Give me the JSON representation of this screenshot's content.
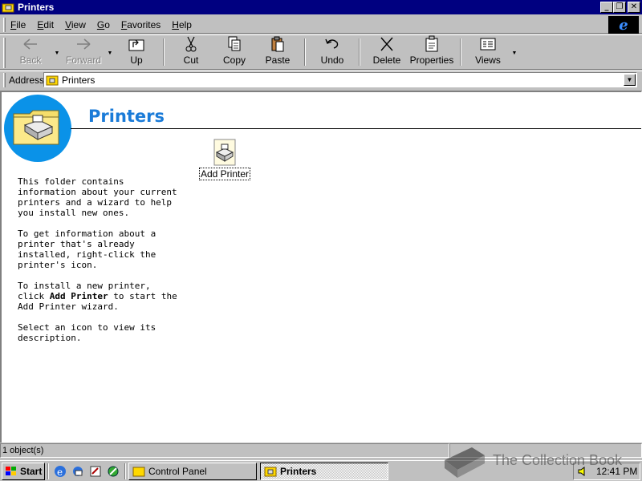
{
  "window": {
    "title": "Printers"
  },
  "title_buttons": {
    "minimize": "_",
    "restore": "❐",
    "close": "✕"
  },
  "menu": [
    {
      "label": "File",
      "key": "F",
      "rest": "ile"
    },
    {
      "label": "Edit",
      "key": "E",
      "rest": "dit"
    },
    {
      "label": "View",
      "key": "V",
      "rest": "iew"
    },
    {
      "label": "Go",
      "key": "G",
      "rest": "o"
    },
    {
      "label": "Favorites",
      "key": "F",
      "rest": "avorites",
      "pre": ""
    },
    {
      "label": "Help",
      "key": "H",
      "rest": "elp"
    }
  ],
  "toolbar": {
    "back": "Back",
    "forward": "Forward",
    "up": "Up",
    "cut": "Cut",
    "copy": "Copy",
    "paste": "Paste",
    "undo": "Undo",
    "delete": "Delete",
    "properties": "Properties",
    "views": "Views"
  },
  "address": {
    "label": "Address",
    "value": "Printers"
  },
  "content": {
    "heading": "Printers",
    "para1": "This folder contains information about your current printers and a wizard to help you install new ones.",
    "para2": "To get information about a printer that's already installed, right-click the printer's icon.",
    "para3_a": "To install a new printer, click ",
    "para3_b": "Add Printer",
    "para3_c": " to start the Add Printer wizard.",
    "para4": "Select an icon to view its description.",
    "item_label": "Add Printer"
  },
  "status": {
    "objects": "1 object(s)"
  },
  "taskbar": {
    "start": "Start",
    "tasks": [
      "Control Panel",
      "Printers"
    ],
    "clock": "12:41 PM"
  },
  "watermark": "The Collection Book",
  "colors": {
    "title_bar": "#000080",
    "heading": "#1a7bd8",
    "circle": "#0a92e8"
  }
}
